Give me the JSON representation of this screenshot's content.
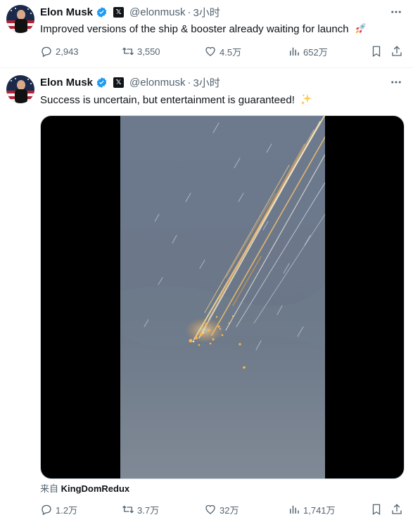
{
  "tweets": [
    {
      "author": {
        "name": "Elon Musk",
        "handle": "@elonmusk",
        "separator": "·",
        "time": "3小时"
      },
      "text": "Improved versions of the ship & booster already waiting for launch",
      "emoji": "rocket",
      "stats": {
        "replies": "2,943",
        "reposts": "3,550",
        "likes": "4.5万",
        "views": "652万"
      }
    },
    {
      "author": {
        "name": "Elon Musk",
        "handle": "@elonmusk",
        "separator": "·",
        "time": "3小时"
      },
      "text": "Success is uncertain, but entertainment is guaranteed!",
      "emoji": "sparkles",
      "media": {
        "type": "video",
        "description_icon": "video-player"
      },
      "source": {
        "prefix": "来自",
        "account": "KingDomRedux"
      },
      "stats": {
        "replies": "1.2万",
        "reposts": "3.7万",
        "likes": "32万",
        "views": "1,741万"
      }
    }
  ],
  "colors": {
    "accent": "#1d9bf0",
    "muted": "#536471",
    "text": "#0f1419",
    "divider": "#eff3f4",
    "sky": "#6f7f94"
  }
}
